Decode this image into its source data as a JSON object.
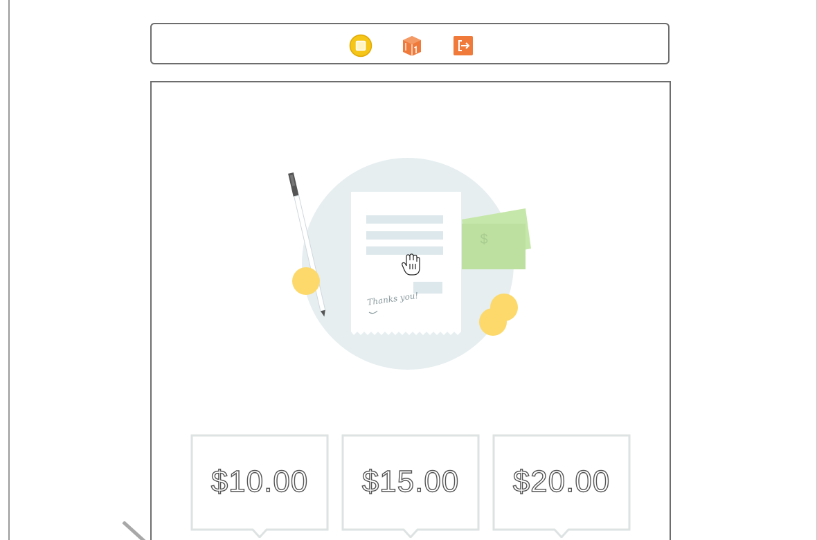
{
  "scene_dock": {
    "icons": [
      {
        "name": "view-controller-icon",
        "color": "#f5c518"
      },
      {
        "name": "first-responder-icon",
        "color": "#f07a3a"
      },
      {
        "name": "exit-icon",
        "color": "#f07a3a"
      }
    ]
  },
  "illustration": {
    "receipt_note": "Thanks you!",
    "money_symbol": "$",
    "colors": {
      "circle": "#e6eef0",
      "coin": "#fcd96a",
      "bill": "#bde0a0",
      "receipt_line": "#dde8ec"
    }
  },
  "tip_options": [
    {
      "amount": "$10.00"
    },
    {
      "amount": "$15.00"
    },
    {
      "amount": "$20.00"
    }
  ]
}
